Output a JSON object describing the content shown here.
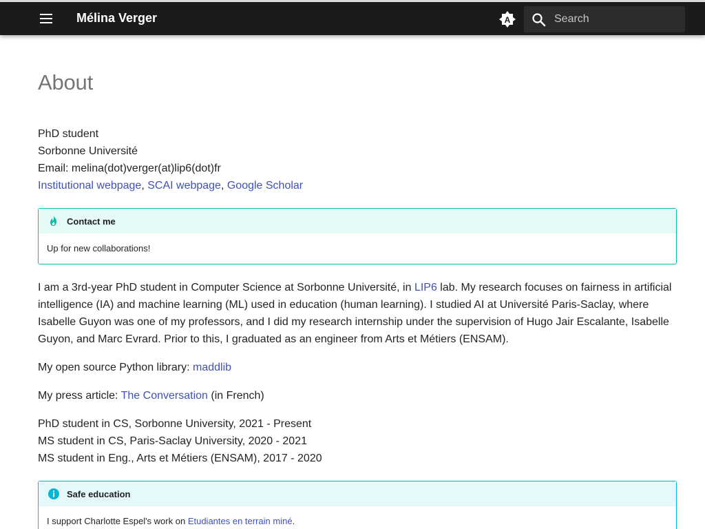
{
  "header": {
    "site_title": "Mélina Verger",
    "search_placeholder": "Search",
    "menu_icon": "menu-icon",
    "palette_icon": "brightness-auto-icon",
    "search_icon": "search-icon"
  },
  "page": {
    "title": "About",
    "info_lines": {
      "role": "PhD student",
      "university": "Sorbonne Université",
      "email": "Email: melina(dot)verger(at)lip6(dot)fr"
    },
    "links": {
      "institutional": "Institutional webpage",
      "sep1": ", ",
      "scai": "SCAI webpage",
      "sep2": ", ",
      "scholar": "Google Scholar"
    },
    "contact_admonition": {
      "title": "Contact me",
      "body": "Up for new collaborations!",
      "icon": "fire-icon"
    },
    "bio": {
      "part1": "I am a 3rd-year PhD student in Computer Science at Sorbonne Université, in ",
      "lab_link": "LIP6",
      "part2": " lab. My research focuses on fairness in artificial intelligence (IA) and machine learning (ML) used in education (human learning). I studied AI at Université Paris-Saclay, where Isabelle Guyon was one of my professors, and I did my research internship under the supervision of Hugo Jair Escalante, Isabelle Guyon, and Marc Evrard. Prior to this, I graduated as an engineer from Arts et Métiers (ENSAM)."
    },
    "library": {
      "prefix": "My open source Python library: ",
      "link": "maddlib"
    },
    "press": {
      "prefix": "My press article: ",
      "link": "The Conversation",
      "suffix": " (in French)"
    },
    "education": [
      "PhD student in CS, Sorbonne University, 2021 - Present",
      "MS student in CS, Paris-Saclay University, 2020 - 2021",
      "MS student in Eng., Arts et Métiers (ENSAM), 2017 - 2020"
    ],
    "safe_admonition": {
      "title": "Safe education",
      "body_prefix": "I support Charlotte Espel's work on ",
      "body_link": "Etudiantes en terrain miné",
      "body_suffix": ".",
      "icon": "info-icon"
    }
  },
  "colors": {
    "header_bg": "#1b1b1d",
    "link": "#4051b5",
    "admonition_tip": "#00bfa5",
    "admonition_info": "#00b8d4"
  }
}
